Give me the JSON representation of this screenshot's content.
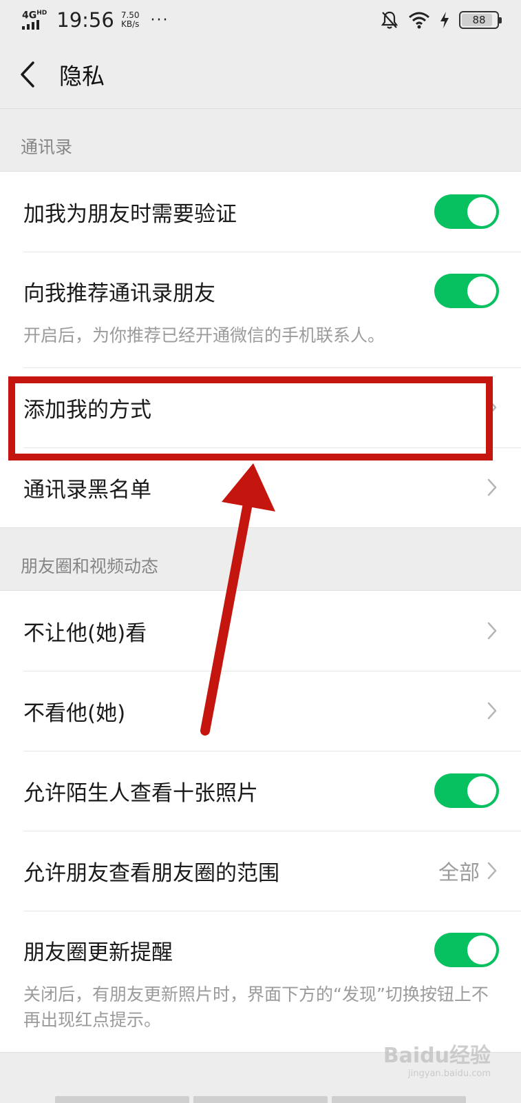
{
  "status_bar": {
    "network": "4G",
    "network_sup": "HD",
    "time": "19:56",
    "speed_value": "7.50",
    "speed_unit": "KB/s",
    "more": "···",
    "battery": "88"
  },
  "nav": {
    "title": "隐私"
  },
  "sections": {
    "contacts_header": "通讯录",
    "moments_header": "朋友圈和视频动态"
  },
  "contacts": {
    "verify_label": "加我为朋友时需要验证",
    "recommend_label": "向我推荐通讯录朋友",
    "recommend_desc": "开启后，为你推荐已经开通微信的手机联系人。",
    "add_methods_label": "添加我的方式",
    "blacklist_label": "通讯录黑名单"
  },
  "moments": {
    "hide_from_label": "不让他(她)看",
    "dont_see_label": "不看他(她)",
    "stranger_label": "允许陌生人查看十张照片",
    "range_label": "允许朋友查看朋友圈的范围",
    "range_value": "全部",
    "reminder_label": "朋友圈更新提醒",
    "reminder_desc": "关闭后，有朋友更新照片时，界面下方的“发现”切换按钮上不再出现红点提示。"
  },
  "watermark": {
    "text": "Baidu经验",
    "sub": "jingyan.baidu.com"
  },
  "colors": {
    "toggle_on": "#07c160",
    "annotation": "#c5150f",
    "background": "#ededed"
  },
  "toggles": {
    "verify": true,
    "recommend": true,
    "stranger": true,
    "reminder": true
  }
}
